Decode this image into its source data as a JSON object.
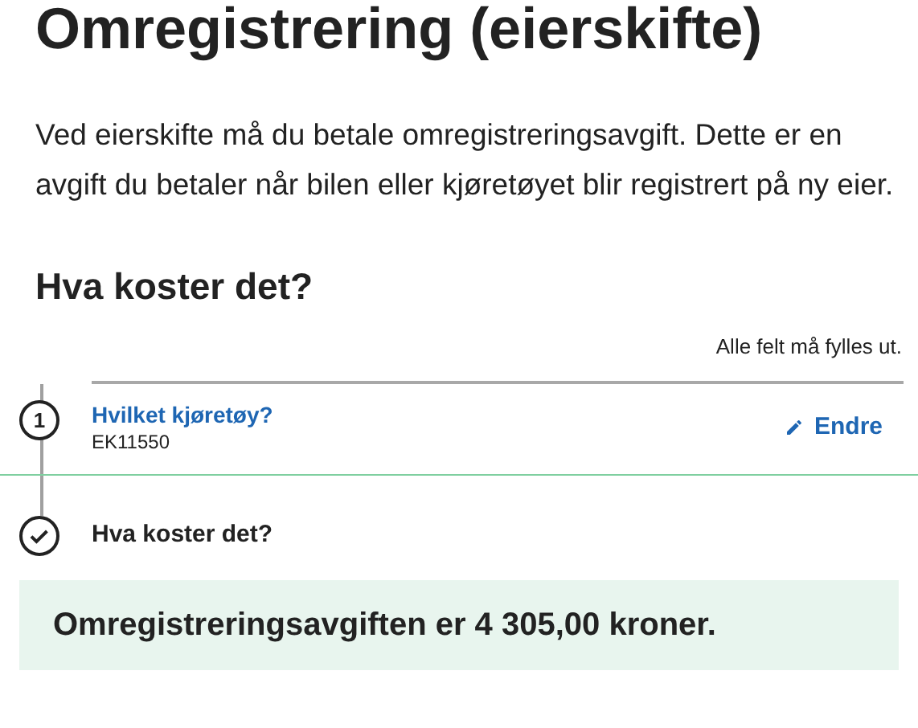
{
  "title": "Omregistrering (eierskifte)",
  "intro": "Ved eierskifte må du betale omregistreringsavgift. Dette er en avgift du betaler når bilen eller kjøretøyet blir registrert på ny eier.",
  "section_title": "Hva koster det?",
  "required_note": "Alle felt må fylles ut.",
  "steps": [
    {
      "kind": "answered",
      "number": "1",
      "title": "Hvilket kjøretøy?",
      "value": "EK11550",
      "action": "Endre"
    },
    {
      "kind": "done",
      "title": "Hva koster det?"
    }
  ],
  "result": "Omregistreringsavgiften er 4 305,00 kroner."
}
